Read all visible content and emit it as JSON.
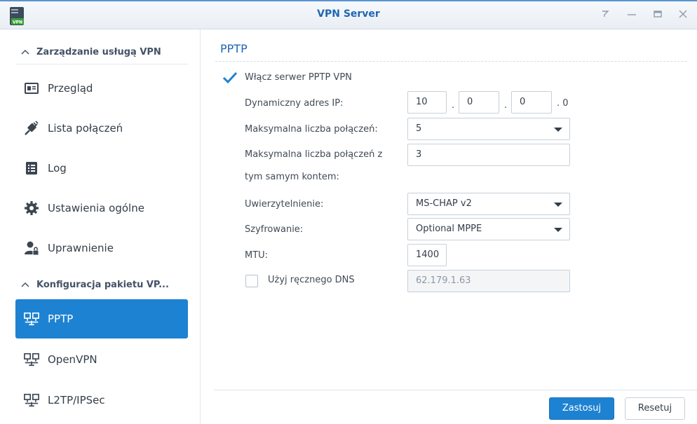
{
  "window": {
    "title": "VPN Server",
    "app_icon_badge": "VPN",
    "controls": [
      "help-icon",
      "minimize-icon",
      "maximize-icon",
      "close-icon"
    ]
  },
  "sidebar": {
    "groups": [
      {
        "label": "Zarządzanie usługą VPN",
        "items": [
          {
            "label": "Przegląd",
            "icon": "overview-icon"
          },
          {
            "label": "Lista połączeń",
            "icon": "plug-icon"
          },
          {
            "label": "Log",
            "icon": "log-icon"
          },
          {
            "label": "Ustawienia ogólne",
            "icon": "gear-icon"
          },
          {
            "label": "Uprawnienie",
            "icon": "user-lock-icon"
          }
        ]
      },
      {
        "label": "Konfiguracja pakietu VP...",
        "items": [
          {
            "label": "PPTP",
            "icon": "network-icon",
            "active": true
          },
          {
            "label": "OpenVPN",
            "icon": "network-icon"
          },
          {
            "label": "L2TP/IPSec",
            "icon": "network-icon"
          }
        ]
      }
    ]
  },
  "main": {
    "section_title": "PPTP",
    "enable_label": "Włącz serwer PPTP VPN",
    "enable_checked": true,
    "ip_label": "Dynamiczny adres IP:",
    "ip_octets": [
      "10",
      "0",
      "0"
    ],
    "ip_last_octet": "0",
    "ip_sep": ".",
    "max_conn_label": "Maksymalna liczba połączeń:",
    "max_conn_value": "5",
    "max_same_label_1": "Maksymalna liczba połączeń z",
    "max_same_label_2": "tym samym kontem:",
    "max_same_value": "3",
    "auth_label": "Uwierzytelnienie:",
    "auth_value": "MS-CHAP v2",
    "enc_label": "Szyfrowanie:",
    "enc_value": "Optional MPPE",
    "mtu_label": "MTU:",
    "mtu_value": "1400",
    "dns_label": "Użyj ręcznego DNS",
    "dns_checked": false,
    "dns_value": "62.179.1.63"
  },
  "footer": {
    "apply_label": "Zastosuj",
    "reset_label": "Resetuj"
  },
  "colors": {
    "accent": "#1e82d2",
    "title": "#1f66b3",
    "check": "#1e82d2"
  }
}
